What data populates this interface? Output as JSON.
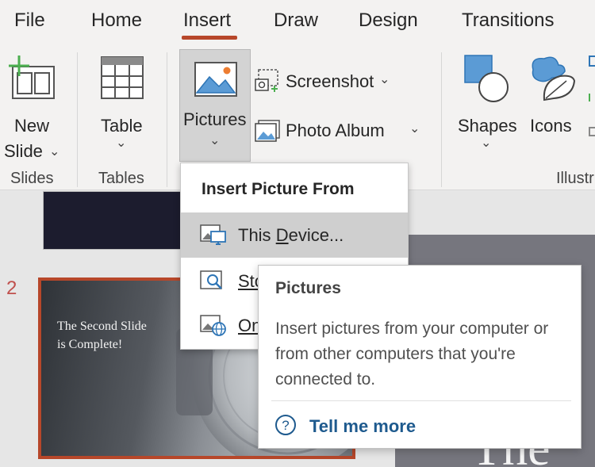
{
  "tabs": [
    {
      "label": "File"
    },
    {
      "label": "Home"
    },
    {
      "label": "Insert"
    },
    {
      "label": "Draw"
    },
    {
      "label": "Design"
    },
    {
      "label": "Transitions"
    }
  ],
  "ribbon": {
    "new_slide_line1": "New",
    "new_slide_line2": "Slide",
    "table_label": "Table",
    "pictures_label": "Pictures",
    "screenshot_label": "Screenshot",
    "photo_album_label": "Photo Album",
    "shapes_label": "Shapes",
    "icons_label": "Icons",
    "groups": {
      "slides": "Slides",
      "tables": "Tables",
      "illustrations": "Illustr"
    }
  },
  "dropdown": {
    "header": "Insert Picture From",
    "items": [
      {
        "label_pre": "This ",
        "label_accel": "D",
        "label_post": "evice..."
      },
      {
        "label": "Sto"
      },
      {
        "label": "On"
      }
    ]
  },
  "tooltip": {
    "title": "Pictures",
    "body": "Insert pictures from your computer or from other computers that you're connected to.",
    "link": "Tell me more"
  },
  "slides": {
    "slide2_number": "2",
    "slide2_text": "The Second Slide is Complete!",
    "background_title": "The"
  },
  "colors": {
    "accent": "#b7472a",
    "link": "#1e5a8e",
    "icon_blue": "#2e75b6",
    "icon_green": "#4caf50"
  }
}
